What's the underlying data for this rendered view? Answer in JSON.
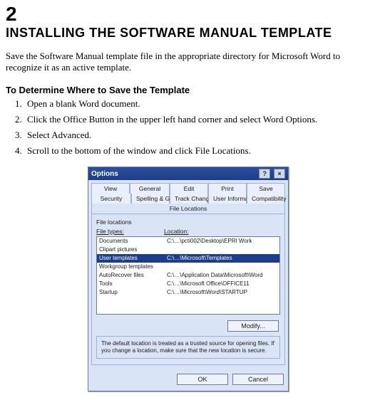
{
  "doc": {
    "chapter_number": "2",
    "title": "INSTALLING THE SOFTWARE MANUAL TEMPLATE",
    "intro": "Save the Software Manual template file in the appropriate directory for Microsoft Word to recognize it as an active template.",
    "subhead": "To Determine Where to Save the Template",
    "steps": [
      "Open a blank Word document.",
      "Click the Office Button in the upper left hand corner and select Word Options.",
      "Select Advanced.",
      "Scroll to the bottom of the window and click File Locations."
    ]
  },
  "dialog": {
    "title": "Options",
    "help_icon": "?",
    "close_icon": "×",
    "tabs_row1": [
      "View",
      "General",
      "Edit",
      "Print",
      "Save"
    ],
    "tabs_row2": [
      "Security",
      "Spelling & Grammar",
      "Track Changes"
    ],
    "tabs_row3": [
      "User Information",
      "Compatibility",
      "File Locations"
    ],
    "active_tab": "File Locations",
    "panel_title": "File locations",
    "col1": "File types:",
    "col2": "Location:",
    "rows": [
      {
        "type": "Documents",
        "loc": "C:\\…\\pcti002\\Desktop\\EPRI Work"
      },
      {
        "type": "Clipart pictures",
        "loc": ""
      },
      {
        "type": "User templates",
        "loc": "C:\\…\\Microsoft\\Templates",
        "selected": true
      },
      {
        "type": "Workgroup templates",
        "loc": ""
      },
      {
        "type": "AutoRecover files",
        "loc": "C:\\…\\Application Data\\Microsoft\\Word"
      },
      {
        "type": "Tools",
        "loc": "C:\\…\\Microsoft Office\\OFFICE11"
      },
      {
        "type": "Startup",
        "loc": "C:\\…\\Microsoft\\Word\\STARTUP"
      }
    ],
    "modify": "Modify...",
    "hint": "The default location is treated as a trusted source for opening files. If you change a location, make sure that the new location is secure.",
    "ok": "OK",
    "cancel": "Cancel"
  }
}
